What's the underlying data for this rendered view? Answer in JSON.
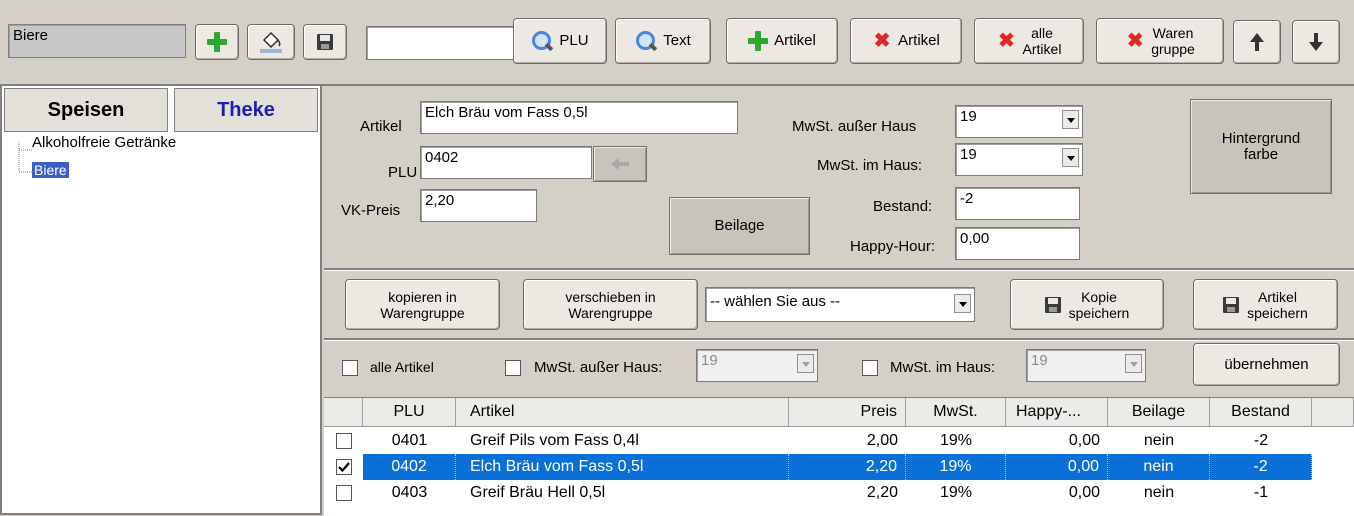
{
  "toolbar": {
    "category_value": "Biere",
    "search_value": "",
    "plu_search_label": "PLU",
    "text_search_label": "Text",
    "add_article_label": "Artikel",
    "delete_article_label": "Artikel",
    "delete_all_label": "alle\nArtikel",
    "delete_group_label": "Waren\ngruppe"
  },
  "tabs": {
    "food": "Speisen",
    "bar": "Theke"
  },
  "tree": {
    "items": [
      "Alkoholfreie Getränke",
      "Biere"
    ]
  },
  "form": {
    "article_label": "Artikel",
    "article_value": "Elch Bräu vom Fass 0,5l",
    "plu_label": "PLU",
    "plu_value": "0402",
    "price_label": "VK-Preis",
    "price_value": "2,20",
    "vat_out_label": "MwSt. außer Haus",
    "vat_out_value": "19",
    "vat_in_label": "MwSt. im Haus:",
    "vat_in_value": "19",
    "stock_label": "Bestand:",
    "stock_value": "-2",
    "happy_label": "Happy-Hour:",
    "happy_value": "0,00",
    "side_dish_button": "Beilage",
    "background_button": "Hintergrund\nfarbe"
  },
  "actions": {
    "copy_label": "kopieren in\nWarengruppe",
    "move_label": "verschieben in\nWarengruppe",
    "select_value": "-- wählen Sie aus --",
    "save_copy_label": "Kopie\nspeichern",
    "save_article_label": "Artikel\nspeichern"
  },
  "bulk": {
    "all_articles_label": "alle Artikel",
    "vat_out_label": "MwSt. außer Haus:",
    "vat_out_value": "19",
    "vat_in_label": "MwSt. im Haus:",
    "vat_in_value": "19",
    "apply_label": "übernehmen"
  },
  "table": {
    "headers": [
      "PLU",
      "Artikel",
      "Preis",
      "MwSt.",
      "Happy-...",
      "Beilage",
      "Bestand"
    ],
    "rows": [
      {
        "checked": false,
        "plu": "0401",
        "artikel": "Greif Pils vom Fass 0,4l",
        "preis": "2,00",
        "mwst": "19%",
        "happy": "0,00",
        "beilage": "nein",
        "bestand": "-2"
      },
      {
        "checked": true,
        "plu": "0402",
        "artikel": "Elch Bräu vom Fass 0,5l",
        "preis": "2,20",
        "mwst": "19%",
        "happy": "0,00",
        "beilage": "nein",
        "bestand": "-2"
      },
      {
        "checked": false,
        "plu": "0403",
        "artikel": "Greif Bräu Hell 0,5l",
        "preis": "2,20",
        "mwst": "19%",
        "happy": "0,00",
        "beilage": "nein",
        "bestand": "-1"
      }
    ]
  },
  "colors": {
    "selection": "#0a6fd6",
    "tab_bar_text": "#1e1eb4",
    "tree_selected": "#3d5fc4"
  }
}
